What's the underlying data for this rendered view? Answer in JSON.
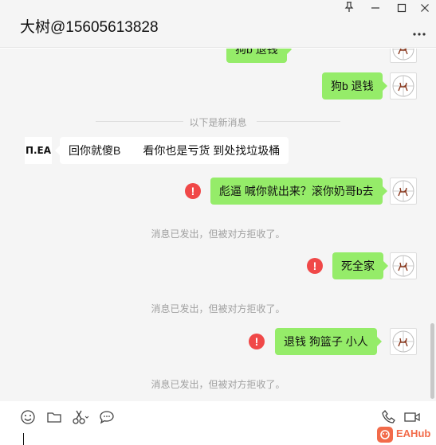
{
  "window": {
    "title": "大树@15605613828",
    "controls": [
      "pin-icon",
      "minimize-icon",
      "maximize-icon",
      "close-icon"
    ]
  },
  "messages": {
    "m0": "狗b 退钱",
    "m1": "狗b 退钱",
    "divider": "以下是新消息",
    "other_avatar_text": "П.ЕА",
    "m2": "回你就傻B　　看你也是亏货 到处找垃圾桶",
    "m3": "彪逼 喊你就出来？滚你奶哥b去",
    "rejected_1": "消息已发出，但被对方拒收了。",
    "m4": "死全家",
    "rejected_2": "消息已发出，但被对方拒收了。",
    "m5": "退钱  狗篮子  小人",
    "rejected_3": "消息已发出，但被对方拒收了。",
    "error_mark": "!"
  },
  "toolbar": {
    "icons": [
      "emoji-icon",
      "folder-icon",
      "scissors-icon",
      "chat-bubble-icon",
      "phone-icon",
      "video-icon"
    ]
  },
  "watermark": {
    "text": "EAHub"
  },
  "colors": {
    "my_bubble": "#95ec69",
    "other_bubble": "#ffffff",
    "error": "#f04848",
    "background": "#f5f5f5"
  }
}
